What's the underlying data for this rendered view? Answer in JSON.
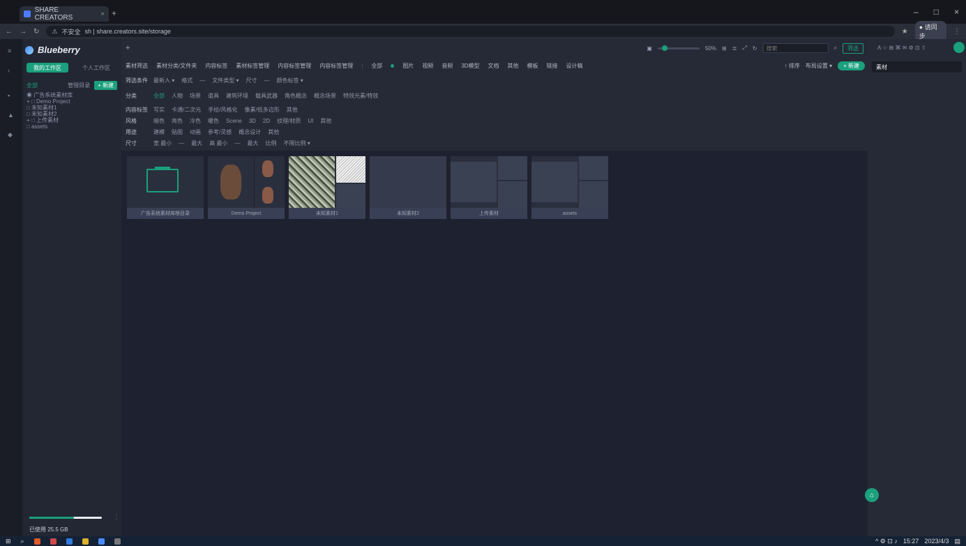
{
  "browser": {
    "tab_title": "SHARE CREATORS",
    "tab_close": "×",
    "new_tab": "+",
    "url_prefix": "不安全",
    "url": "sh | share.creators.site/storage",
    "profile_label": "● 请同步",
    "window_controls": [
      "–",
      "□",
      "×"
    ]
  },
  "app": {
    "logo": "Blueberry",
    "panel_tabs": [
      "我的工作区",
      "个人工作区"
    ],
    "tree_header": {
      "selected": "全部",
      "manage": "管理目录",
      "new": "+ 新建"
    },
    "tree_items": [
      "◉ 广告系统素材库",
      "+ □ Demo Project",
      "  □ 未知素材1",
      "  □ 未知素材2",
      "+ □ 上传素材",
      "  □ assets"
    ],
    "storage": {
      "label": "已使用 25.5 GB",
      "used_fraction": 0.62
    }
  },
  "toolbar": {
    "plus": "+",
    "zoom_label": "50%",
    "search_placeholder": "搜索",
    "filter_button": "筛选",
    "categories": [
      "素材筛选",
      "素材分类/文件夹",
      "内容标签",
      "素材标签管理",
      "内容标签管理",
      "内容标签管理"
    ],
    "view_modes": [
      "全部",
      "图片",
      "视频",
      "音频",
      "3D模型",
      "文档",
      "其他",
      "模板",
      "链接",
      "设计稿"
    ],
    "right_actions": {
      "sort": "↑ 排序",
      "layout": "布局设置 ▾",
      "new": "+ 新建"
    },
    "filter_rows": [
      {
        "label": "筛选条件",
        "items": [
          "最新入 ▾",
          "格式",
          "—",
          "文件类型 ▾",
          "尺寸",
          "—",
          "颜色标签 ▾"
        ]
      },
      {
        "label": "分类",
        "items": [
          "全部",
          "人物",
          "场景",
          "道具",
          "建筑环境",
          "载具武器",
          "角色概念",
          "概念场景",
          "特效元素/特效"
        ]
      },
      {
        "label": "内容标签",
        "items": [
          "写实",
          "卡通/二次元",
          "手绘/风格化",
          "像素/低多边形",
          "其他"
        ]
      },
      {
        "label": "风格",
        "items": [
          "暗色",
          "亮色",
          "冷色",
          "暖色",
          "Scene",
          "3D",
          "2D",
          "纹理/材质",
          "UI",
          "其他"
        ]
      },
      {
        "label": "用途",
        "items": [
          "建模",
          "贴图",
          "动画",
          "参考/灵感",
          "概念设计",
          "其他"
        ]
      },
      {
        "label": "尺寸",
        "items": [
          "宽 最小",
          "—",
          "最大",
          "高 最小",
          "—",
          "最大",
          "比例",
          "不限比例 ▾"
        ]
      }
    ]
  },
  "cards": [
    {
      "name": "广告系统素材库根目录"
    },
    {
      "name": "Demo Project"
    },
    {
      "name": "未知素材1"
    },
    {
      "name": "未知素材2"
    },
    {
      "name": "上传素材"
    },
    {
      "name": "assets"
    }
  ],
  "right_panel": {
    "title": "素材",
    "icons": "A ☆ ⊞ ⌘ ✉ ⚙ ⊡ ⇧"
  },
  "taskbar": {
    "clock": "15:27",
    "date": "2023/4/3"
  },
  "colors": {
    "accent": "#1aa07c",
    "bg": "#1e2230",
    "panel": "#262a36"
  }
}
